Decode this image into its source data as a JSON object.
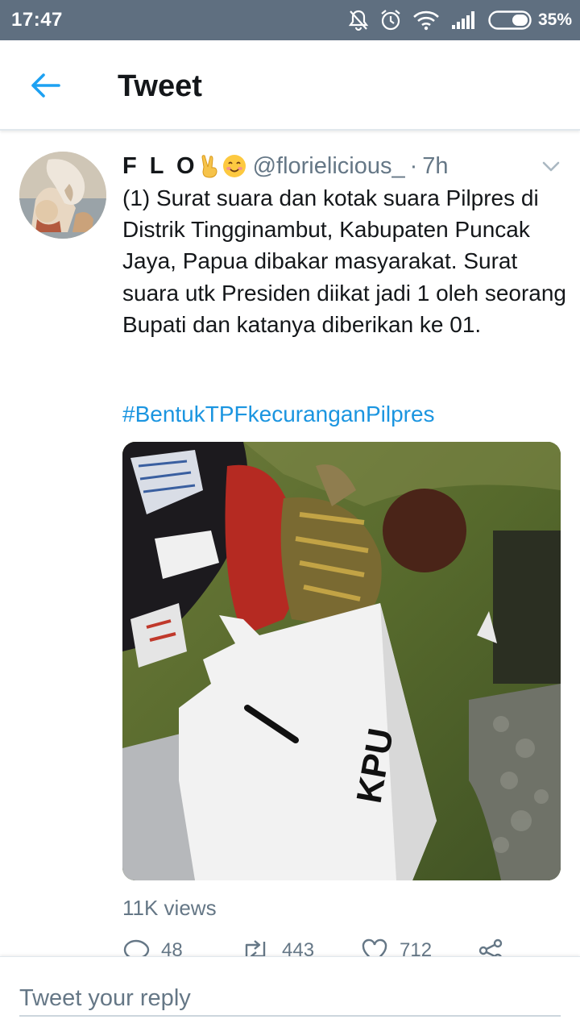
{
  "status_bar": {
    "time": "17:47",
    "battery_percent": "35%",
    "icons": [
      "mute-bell-icon",
      "alarm-icon",
      "wifi-icon",
      "signal-icon",
      "battery-icon"
    ],
    "background": "#5f6f80"
  },
  "header": {
    "back_icon": "arrow-left-icon",
    "title": "Tweet",
    "accent": "#1da1f2"
  },
  "tweet": {
    "display_name": "F L O",
    "name_emojis": [
      "victory-hand-emoji",
      "smiling-face-emoji"
    ],
    "handle": "@florielicious_",
    "separator": "·",
    "time": "7h",
    "text": "(1) Surat suara dan kotak suara Pilpres di Distrik Tingginambut, Kabupaten Puncak Jaya, Papua dibakar masyarakat. Surat suara utk Presiden diikat jadi 1 oleh seorang Bupati dan katanya diberikan ke 01.",
    "hashtag": "#BentukTPFkecuranganPilpres",
    "hashtag_color": "#1b95e0",
    "media": {
      "box_label_number": "1",
      "box_label_text": "KPU"
    },
    "views": "11K views",
    "actions": {
      "reply_count": "48",
      "retweet_count": "443",
      "like_count": "712"
    }
  },
  "reply": {
    "placeholder": "Tweet your reply"
  }
}
